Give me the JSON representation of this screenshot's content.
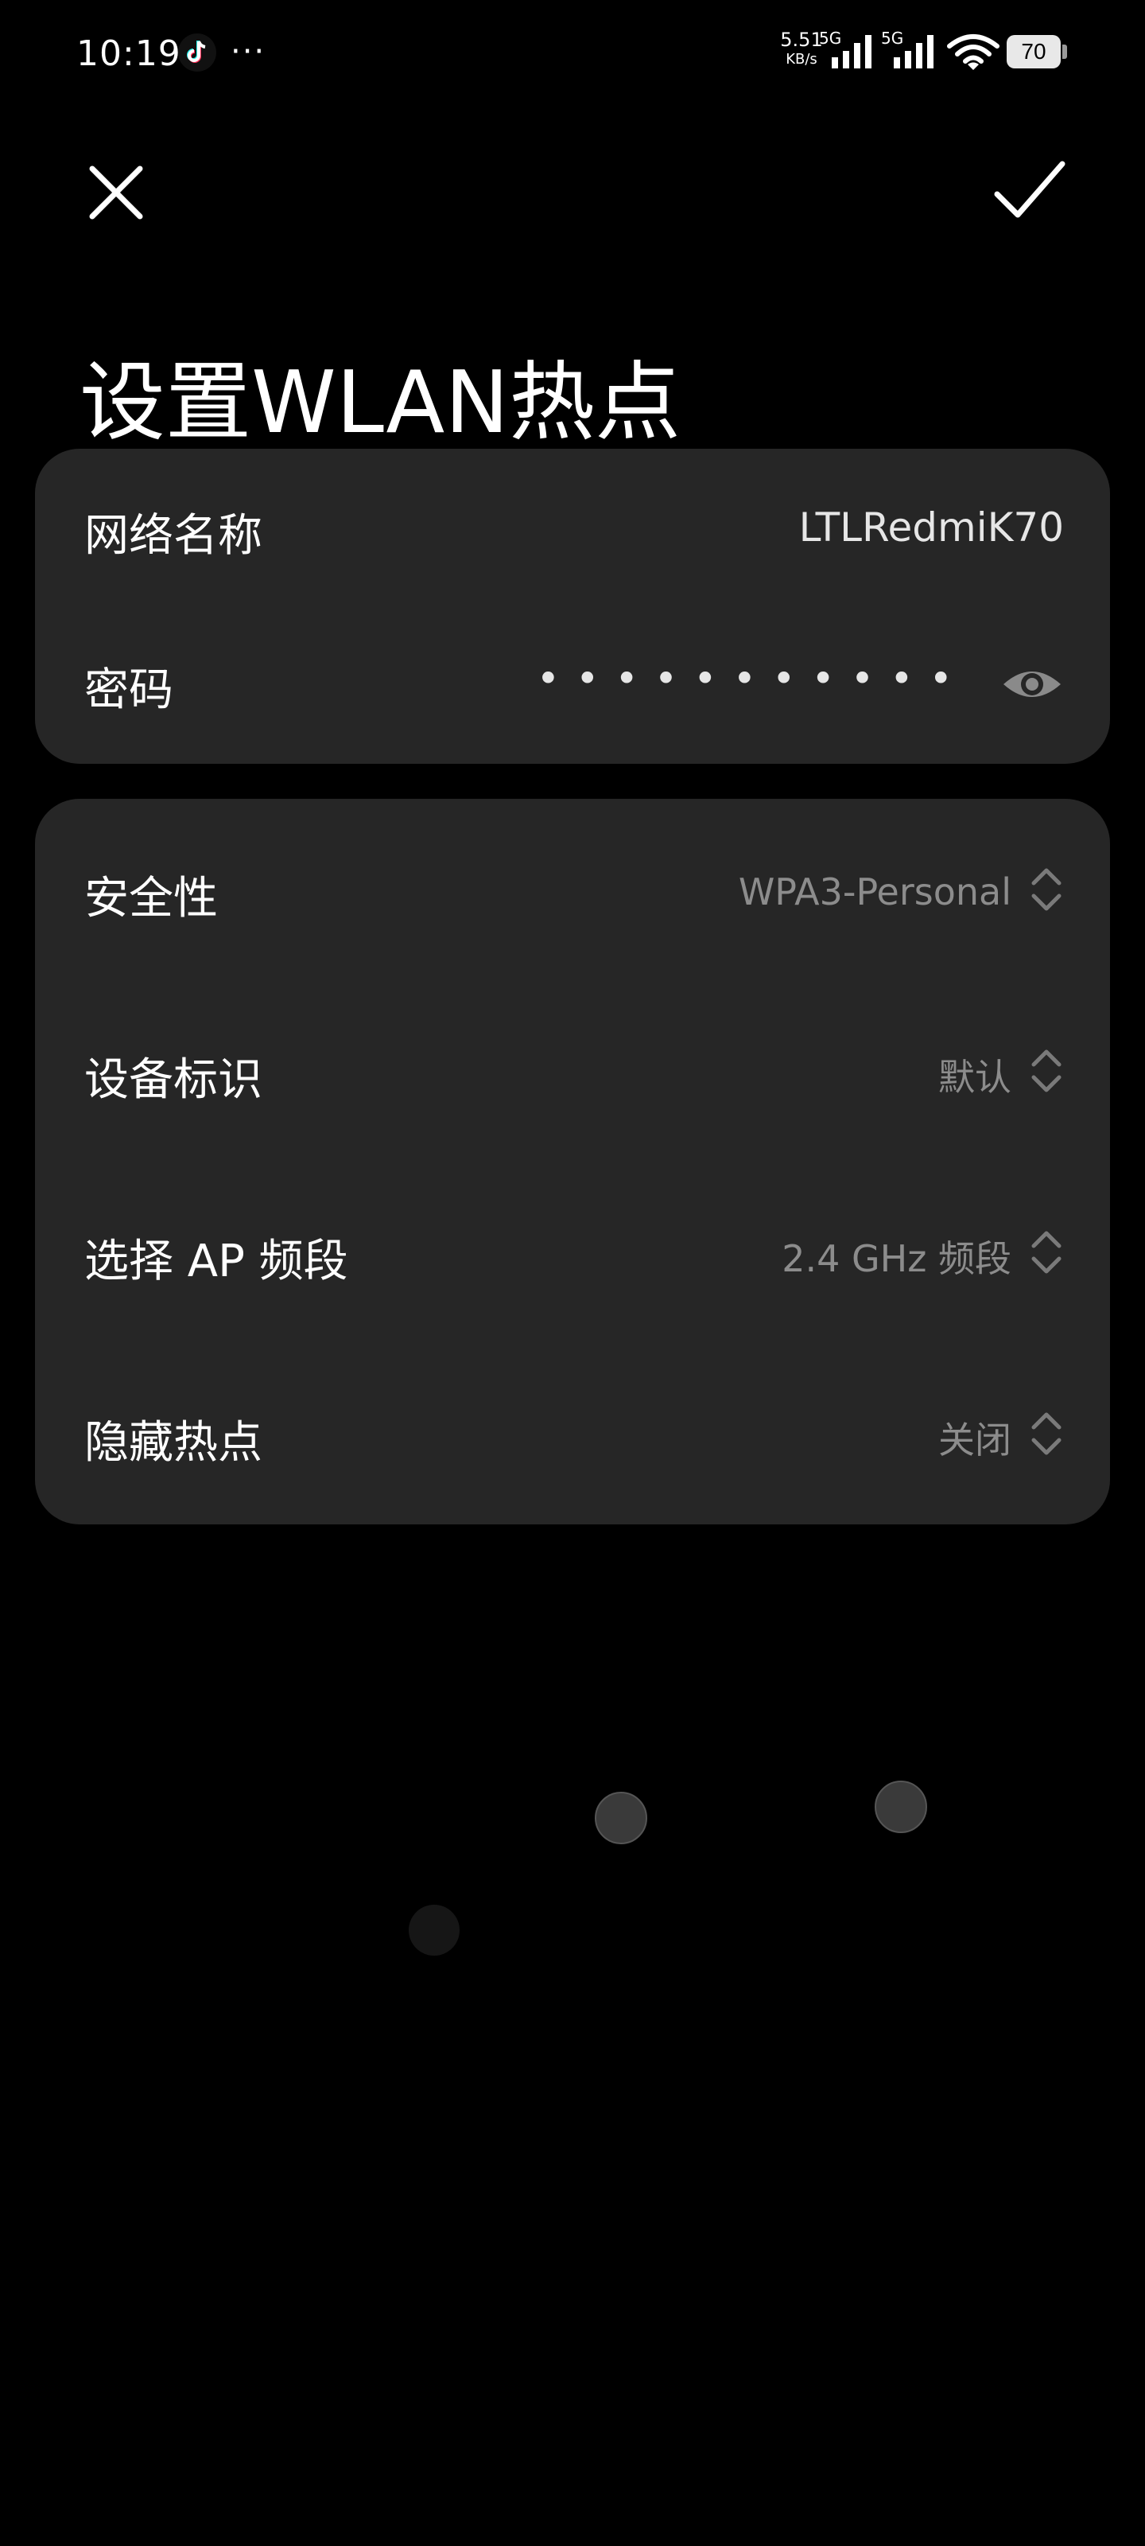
{
  "status_bar": {
    "time": "10:19",
    "more": "···",
    "net_speed_value": "5.51",
    "net_speed_unit": "KB/s",
    "signal1_label": "5G",
    "signal2_label": "5G",
    "battery": "70",
    "icons": [
      "tiktok-icon",
      "signal-icon",
      "signal-icon",
      "wifi-icon",
      "battery-icon"
    ]
  },
  "header": {
    "title": "设置WLAN热点",
    "close_icon": "close-icon",
    "confirm_icon": "check-icon"
  },
  "network_card": {
    "name_label": "网络名称",
    "name_value": "LTLRedmiK70",
    "password_label": "密码",
    "password_value": "• • • • • • • • • • •",
    "eye_icon": "eye-icon"
  },
  "settings_card": {
    "rows": [
      {
        "label": "安全性",
        "value": "WPA3-Personal"
      },
      {
        "label": "设备标识",
        "value": "默认"
      },
      {
        "label": "选择 AP 频段",
        "value": "2.4 GHz 频段"
      },
      {
        "label": "隐藏热点",
        "value": "关闭"
      }
    ]
  },
  "colors": {
    "background": "#000000",
    "card": "#262626",
    "value_text": "#8c8c8c",
    "primary_text": "#ffffff"
  }
}
